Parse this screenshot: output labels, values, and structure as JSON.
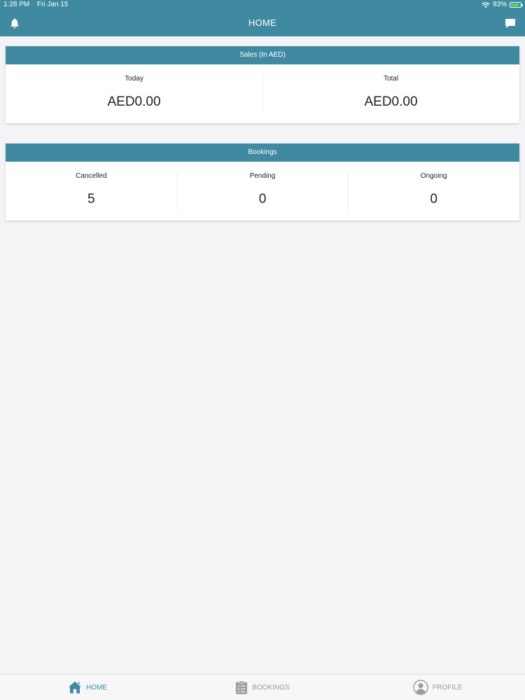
{
  "status_bar": {
    "time": "1:28 PM",
    "date": "Fri Jan 15",
    "battery": "83%",
    "battery_level": 0.83
  },
  "nav": {
    "title": "HOME",
    "left_icon": "bell-icon",
    "right_icon": "chat-icon"
  },
  "sales": {
    "header": "Sales (In AED)",
    "today_label": "Today",
    "today_value": "AED0.00",
    "total_label": "Total",
    "total_value": "AED0.00"
  },
  "bookings": {
    "header": "Bookings",
    "cancelled_label": "Cancelled",
    "cancelled_value": "5",
    "pending_label": "Pending",
    "pending_value": "0",
    "ongoing_label": "Ongoing",
    "ongoing_value": "0"
  },
  "tabbar": {
    "home": "HOME",
    "bookings": "BOOKINGS",
    "profile": "PROFILE",
    "active": "home"
  },
  "colors": {
    "primary": "#3f8aa0",
    "background": "#f4f4f6",
    "inactive": "#9a9a9a"
  }
}
